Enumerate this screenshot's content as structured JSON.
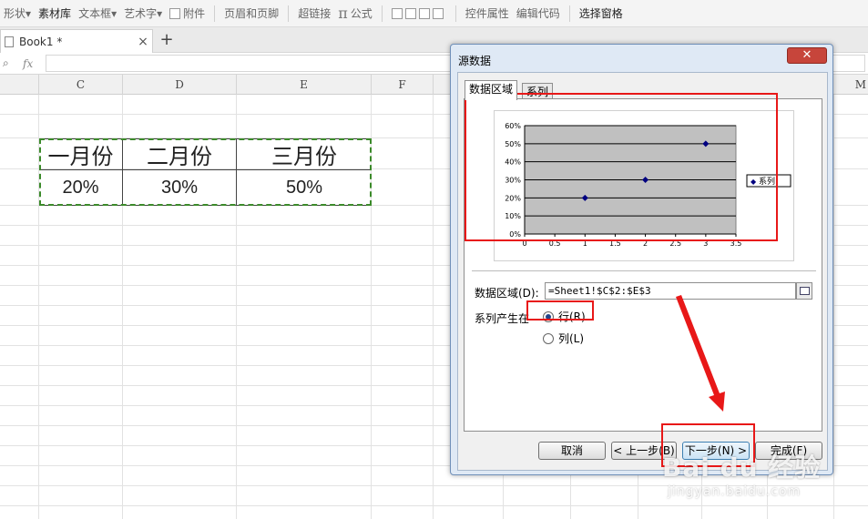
{
  "ribbon": {
    "items": [
      {
        "label": "形状",
        "dropdown": true
      },
      {
        "label": "素材库",
        "dropdown": false
      },
      {
        "label": "文本框",
        "dropdown": true
      },
      {
        "label": "艺术字",
        "dropdown": true
      },
      {
        "label": "附件",
        "dropdown": false
      },
      {
        "label": "页眉和页脚",
        "dropdown": false
      },
      {
        "label": "超链接",
        "dropdown": false
      },
      {
        "label": "公式",
        "dropdown": false
      },
      {
        "label": "控件属性",
        "dropdown": false
      },
      {
        "label": "编辑代码",
        "dropdown": false
      },
      {
        "label": "选择窗格",
        "dropdown": false
      }
    ],
    "pi_symbol": "π"
  },
  "tabbar": {
    "book_title": "Book1 *",
    "close_glyph": "×",
    "add_glyph": "+"
  },
  "formula_bar": {
    "fx": "fx",
    "zoom_glyph": "🔍"
  },
  "columns": [
    "C",
    "D",
    "E",
    "F",
    "M"
  ],
  "sheet_table": {
    "headers": [
      "一月份",
      "二月份",
      "三月份"
    ],
    "values": [
      "20%",
      "30%",
      "50%"
    ]
  },
  "dialog": {
    "title": "源数据",
    "close_glyph": "✕",
    "tabs": [
      "数据区域",
      "系列"
    ],
    "range_label": "数据区域(D):",
    "range_value": "=Sheet1!$C$2:$E$3",
    "series_in_label": "系列产生在",
    "radio_row_label": "行(R)",
    "radio_col_label": "列(L)",
    "buttons": {
      "cancel": "取消",
      "prev": "< 上一步(B)",
      "next": "下一步(N) >",
      "finish": "完成(F)"
    }
  },
  "chart_data": {
    "type": "scatter",
    "series": [
      {
        "name": "系列",
        "x": [
          1,
          2,
          3
        ],
        "y": [
          20,
          30,
          50
        ]
      }
    ],
    "x_ticks": [
      "0",
      "0.5",
      "1",
      "1.5",
      "2",
      "2.5",
      "3",
      "3.5"
    ],
    "y_ticks": [
      "0%",
      "10%",
      "20%",
      "30%",
      "40%",
      "50%",
      "60%"
    ],
    "xlim": [
      0,
      3.5
    ],
    "ylim": [
      0,
      60
    ],
    "grid": true,
    "plot_background": "#c0c0c0",
    "marker_color": "#000080",
    "legend_position": "right",
    "legend_marker": "◆"
  },
  "watermark": {
    "main": "Bai du 经验",
    "sub": "jingyan.baidu.com"
  },
  "colors": {
    "annotation_red": "#e81818",
    "marching_ants": "#3b8a2a"
  }
}
